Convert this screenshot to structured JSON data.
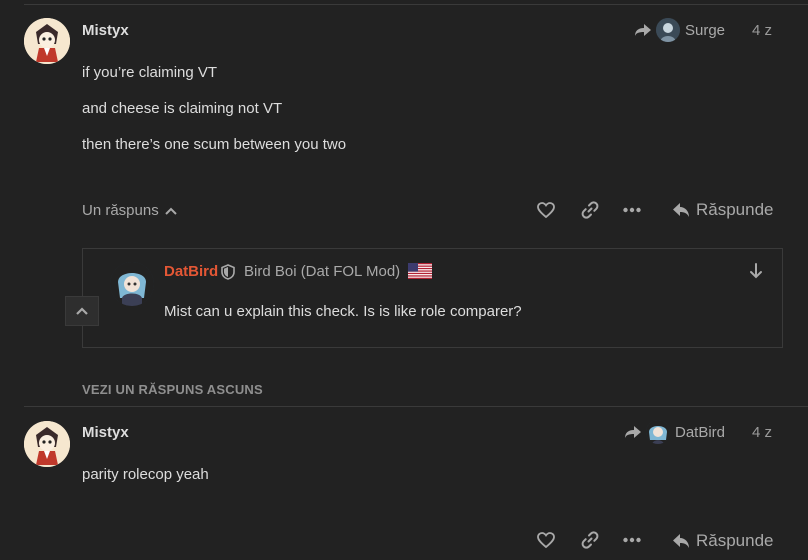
{
  "posts": [
    {
      "username": "Mistyx",
      "reply_to": "Surge",
      "date": "4 z",
      "lines": [
        "if you’re claiming VT",
        "and cheese is claiming not VT",
        "then there’s one scum between you two"
      ],
      "replies_label": "Un răspuns",
      "reply_label": "Răspunde"
    },
    {
      "username": "Mistyx",
      "reply_to": "DatBird",
      "date": "4 z",
      "lines": [
        "parity rolecop yeah"
      ],
      "reply_label": "Răspunde"
    }
  ],
  "embedded_reply": {
    "username": "DatBird",
    "user_title": "Bird Boi (Dat FOL Mod)",
    "text": "Mist can u explain this check. Is is like role comparer?"
  },
  "hidden_replies_label": "VEZI UN RĂSPUNS ASCUNS",
  "colors": {
    "background": "#222222",
    "text": "#dddddd",
    "muted": "#a9a9a9",
    "username_highlight": "#e45735"
  }
}
